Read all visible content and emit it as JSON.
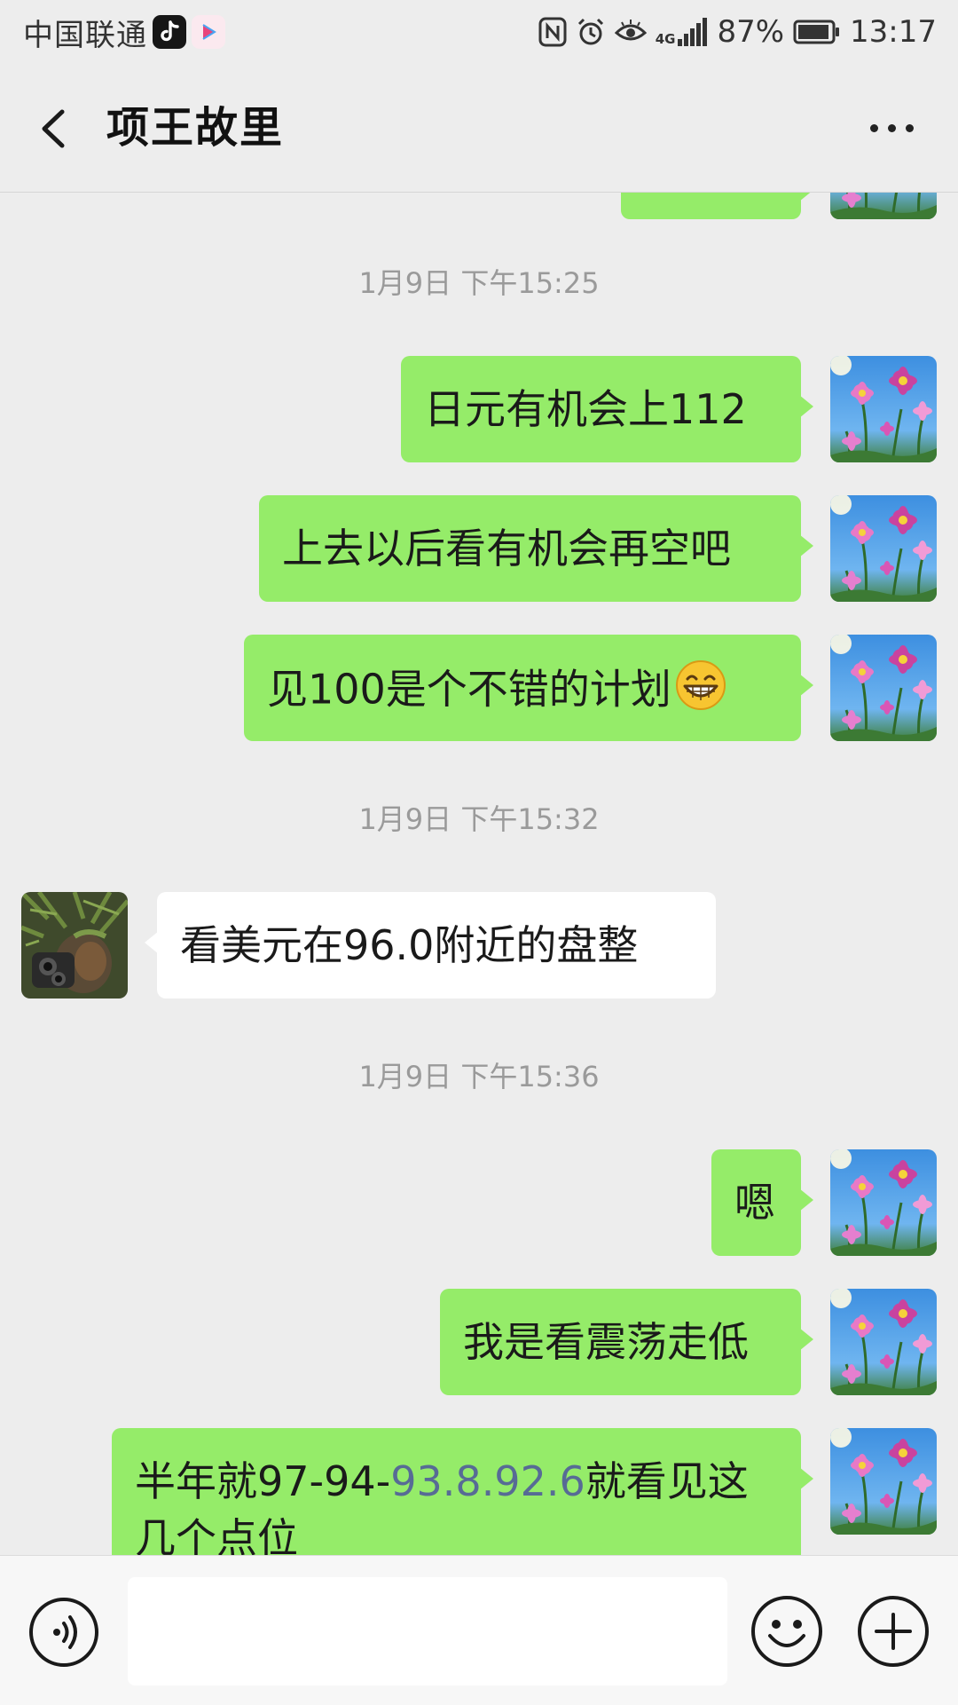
{
  "status_bar": {
    "carrier": "中国联通",
    "battery": "87%",
    "time": "13:17",
    "network": "4G",
    "icons": [
      "tiktok-icon",
      "video-app-icon",
      "nfc-icon",
      "alarm-icon",
      "eye-icon",
      "signal-icon",
      "battery-icon"
    ]
  },
  "header": {
    "title": "项王故里",
    "back_icon": "chevron-left-icon",
    "more_icon": "more-dots-icon"
  },
  "messages": [
    {
      "type": "timestamp",
      "text": "1月9日 下午15:25"
    },
    {
      "type": "sent",
      "text": "日元有机会上112"
    },
    {
      "type": "sent",
      "text": "上去以后看有机会再空吧"
    },
    {
      "type": "sent",
      "text": "见100是个不错的计划",
      "emoji": "grinning-face-icon"
    },
    {
      "type": "timestamp",
      "text": "1月9日 下午15:32"
    },
    {
      "type": "received",
      "text": "看美元在96.0附近的盘整"
    },
    {
      "type": "timestamp",
      "text": "1月9日 下午15:36"
    },
    {
      "type": "sent",
      "text": "嗯"
    },
    {
      "type": "sent",
      "text": "我是看震荡走低"
    },
    {
      "type": "sent",
      "text_prefix": "半年就97-94-",
      "text_link": "93.8.92.6",
      "text_suffix": "就看见这几个点位"
    }
  ],
  "input_bar": {
    "voice_icon": "voice-icon",
    "emoji_icon": "emoji-icon",
    "plus_icon": "plus-icon",
    "input_value": ""
  },
  "colors": {
    "sent_bubble": "#95ec69",
    "received_bubble": "#ffffff",
    "background": "#ededed",
    "link": "#576b95"
  }
}
